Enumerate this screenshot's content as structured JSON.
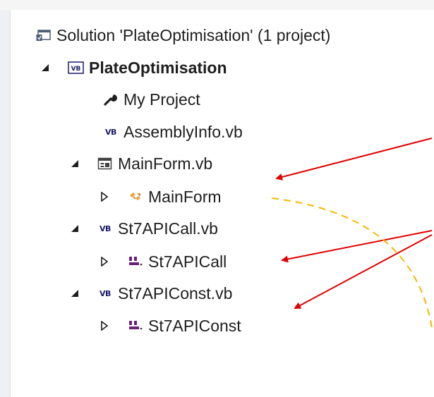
{
  "solution_explorer": {
    "solution_label": "Solution 'PlateOptimisation' (1 project)",
    "project_label": "PlateOptimisation",
    "items": [
      {
        "label": "My Project",
        "icon": "wrench-icon"
      },
      {
        "label": "AssemblyInfo.vb",
        "icon": "vb-file-icon"
      },
      {
        "label": "MainForm.vb",
        "icon": "form-file-icon"
      },
      {
        "label": "MainForm",
        "icon": "form-class-icon"
      },
      {
        "label": "St7APICall.vb",
        "icon": "vb-file-icon"
      },
      {
        "label": "St7APICall",
        "icon": "module-icon"
      },
      {
        "label": "St7APIConst.vb",
        "icon": "vb-file-icon"
      },
      {
        "label": "St7APIConst",
        "icon": "module-icon"
      }
    ]
  },
  "annotations": {
    "arrow_color": "#e00000",
    "dashed_color": "#f5b800"
  }
}
